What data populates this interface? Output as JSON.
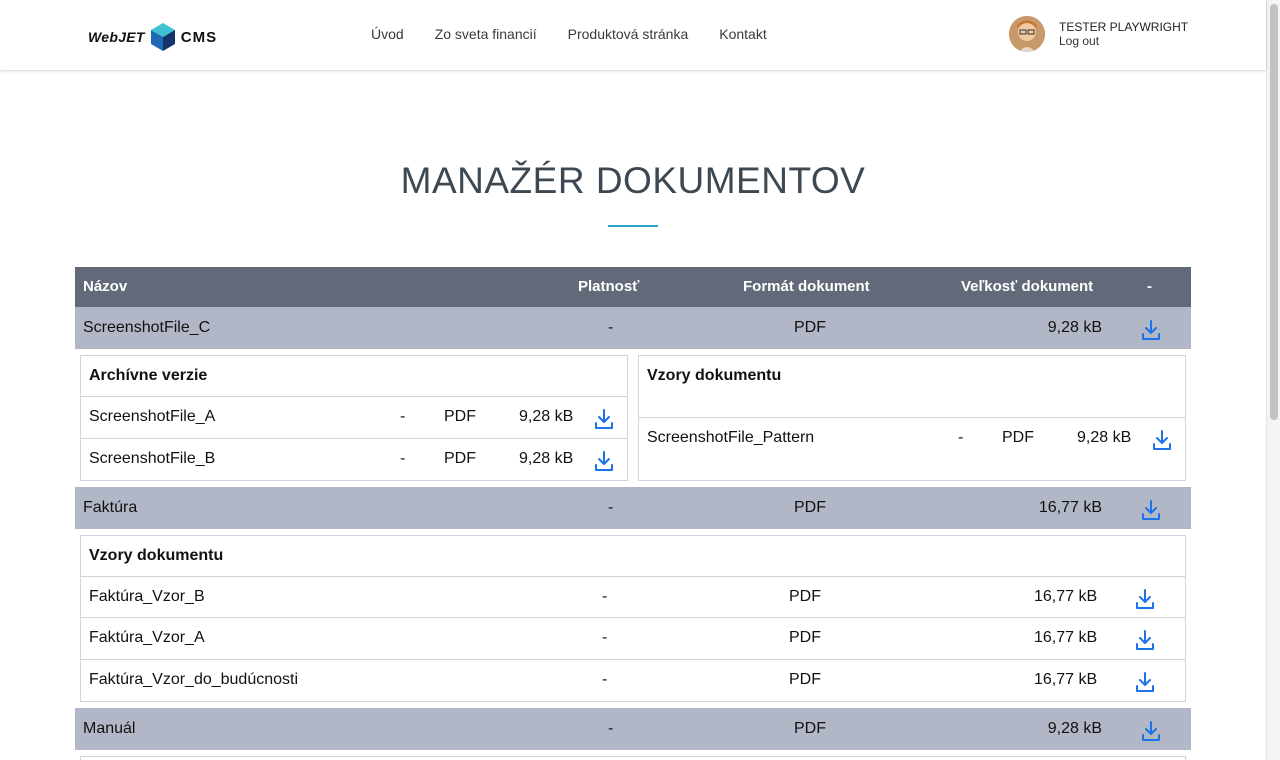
{
  "brand": {
    "logo_word": "WebJET",
    "logo_suffix": "CMS",
    "accent": "#2aa3c4"
  },
  "nav": {
    "items": [
      "Úvod",
      "Zo sveta financií",
      "Produktová stránka",
      "Kontakt"
    ]
  },
  "user": {
    "name": "TESTER PLAYWRIGHT",
    "logout": "Log out"
  },
  "page": {
    "title": "MANAŽÉR DOKUMENTOV"
  },
  "table": {
    "headers": {
      "name": "Názov",
      "validity": "Platnosť",
      "format": "Formát dokument",
      "size": "Veľkosť dokument",
      "action": "-"
    },
    "rows": [
      {
        "name": "ScreenshotFile_C",
        "validity": "-",
        "format": "PDF",
        "size": "9,28 kB",
        "archive_title": "Archívne verzie",
        "archive": [
          {
            "name": "ScreenshotFile_A",
            "validity": "-",
            "format": "PDF",
            "size": "9,28 kB"
          },
          {
            "name": "ScreenshotFile_B",
            "validity": "-",
            "format": "PDF",
            "size": "9,28 kB"
          }
        ],
        "patterns_title": "Vzory dokumentu",
        "patterns": [
          {
            "name": "ScreenshotFile_Pattern",
            "validity": "-",
            "format": "PDF",
            "size": "9,28 kB"
          }
        ]
      },
      {
        "name": "Faktúra",
        "validity": "-",
        "format": "PDF",
        "size": "16,77 kB",
        "patterns_title": "Vzory dokumentu",
        "patterns": [
          {
            "name": "Faktúra_Vzor_B",
            "validity": "-",
            "format": "PDF",
            "size": "16,77 kB"
          },
          {
            "name": "Faktúra_Vzor_A",
            "validity": "-",
            "format": "PDF",
            "size": "16,77 kB"
          },
          {
            "name": "Faktúra_Vzor_do_budúcnosti",
            "validity": "-",
            "format": "PDF",
            "size": "16,77 kB"
          }
        ]
      },
      {
        "name": "Manuál",
        "validity": "-",
        "format": "PDF",
        "size": "9,28 kB"
      }
    ]
  },
  "icons": {
    "download": "download-icon",
    "avatar": "avatar"
  },
  "colors": {
    "header_bg": "#626a7a",
    "row_bg": "#b1b7c6",
    "download": "#1a73e8"
  }
}
